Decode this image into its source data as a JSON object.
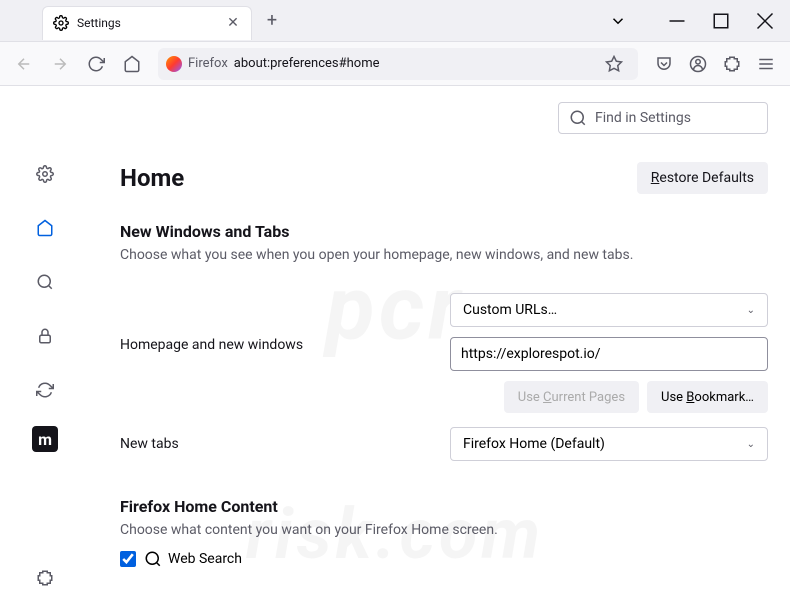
{
  "tab": {
    "title": "Settings"
  },
  "urlbar": {
    "label": "Firefox",
    "url": "about:preferences#home"
  },
  "search": {
    "placeholder": "Find in Settings"
  },
  "page": {
    "title": "Home",
    "restore": "Restore Defaults"
  },
  "section1": {
    "title": "New Windows and Tabs",
    "desc": "Choose what you see when you open your homepage, new windows, and new tabs."
  },
  "homepage": {
    "label": "Homepage and new windows",
    "dropdown": "Custom URLs…",
    "url": "https://explorespot.io/",
    "useCurrent": "Use Current Pages",
    "useBookmark": "Use Bookmark…"
  },
  "newtabs": {
    "label": "New tabs",
    "dropdown": "Firefox Home (Default)"
  },
  "section2": {
    "title": "Firefox Home Content",
    "desc": "Choose what content you want on your Firefox Home screen."
  },
  "websearch": {
    "label": "Web Search"
  }
}
